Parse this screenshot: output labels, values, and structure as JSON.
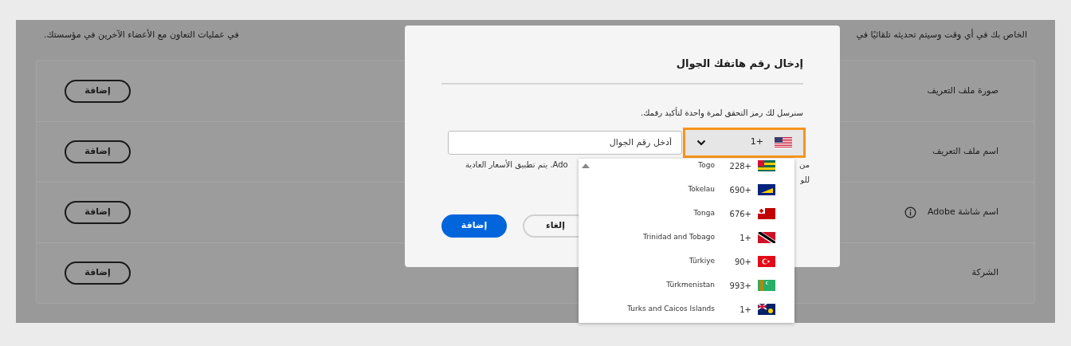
{
  "background_text": {
    "right": "الخاص بك في أي وقت وسيتم تحديثه تلقائيًا في",
    "left": "في عمليات التعاون مع الأعضاء الآخرين في مؤسستك."
  },
  "profile_rows": [
    {
      "label": "صورة ملف التعريف",
      "info": false,
      "button": "إضافة"
    },
    {
      "label": "اسم ملف التعريف",
      "info": false,
      "button": "إضافة"
    },
    {
      "label": "اسم شاشة Adobe",
      "info": true,
      "button": "إضافة"
    },
    {
      "label": "الشركة",
      "info": false,
      "button": "إضافة"
    }
  ],
  "dialog": {
    "title": "إدخال رقم هاتفك الجوال",
    "message": "سنرسل لك رمز التحقق لمرة واحدة لتأكيد رقمك.",
    "country_select": {
      "code": "1+",
      "focused": true
    },
    "phone_field": {
      "placeholder": "أدخل رقم الجوال"
    },
    "note_fragments": [
      "من",
      "للو",
      "Ado. يتم تطبيق الأسعار العادية"
    ],
    "buttons": [
      {
        "label": "إلغاء",
        "kind": "secondary"
      },
      {
        "label": "إضافة",
        "kind": "primary"
      }
    ]
  },
  "country_list": [
    {
      "name": "Togo",
      "code": "228+"
    },
    {
      "name": "Tokelau",
      "code": "690+"
    },
    {
      "name": "Tonga",
      "code": "676+"
    },
    {
      "name": "Trinidad and Tobago",
      "code": "1+"
    },
    {
      "name": "Türkiye",
      "code": "90+"
    },
    {
      "name": "Türkmenistan",
      "code": "993+"
    },
    {
      "name": "Turks and Caicos Islands",
      "code": "1+"
    }
  ]
}
